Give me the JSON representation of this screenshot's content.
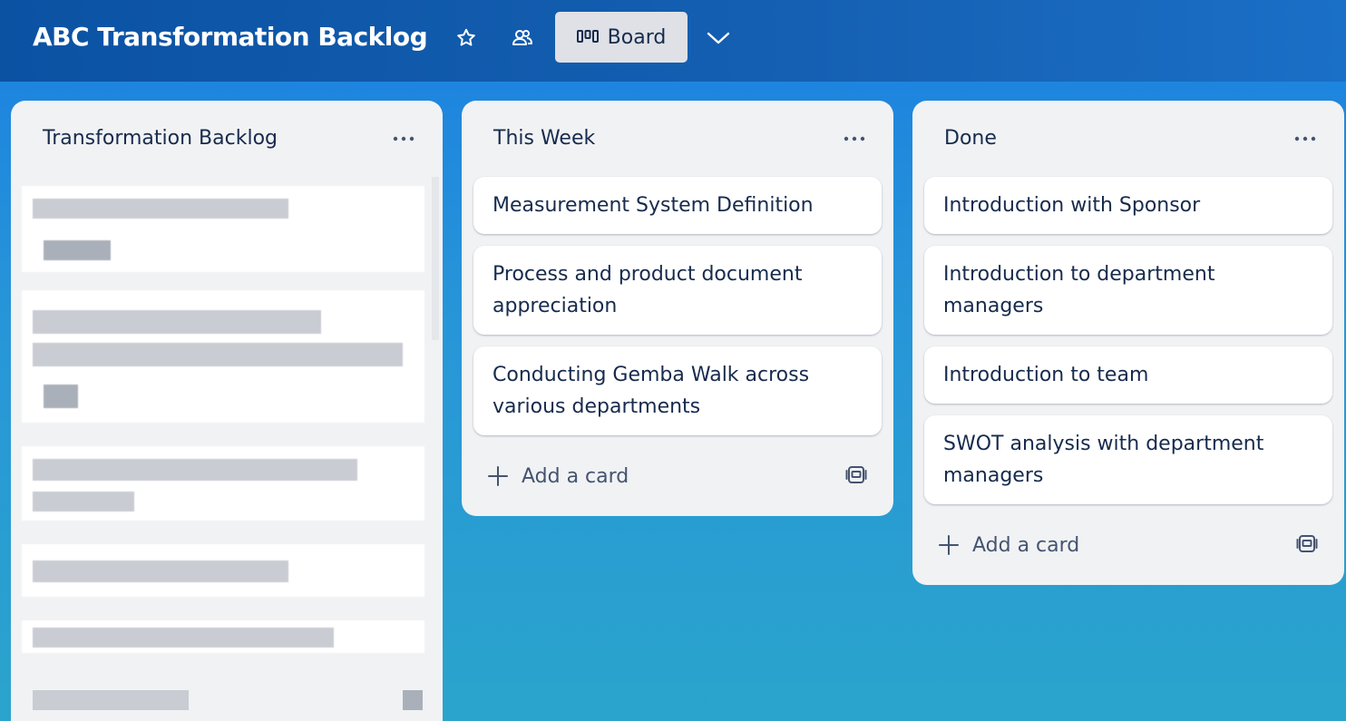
{
  "header": {
    "board_title": "ABC Transformation Backlog",
    "star_icon": "star-icon",
    "visibility_icon": "workspace-visibility-icon",
    "view_icon": "board-view-icon",
    "view_label": "Board",
    "view_switch_icon": "chevron-down-icon"
  },
  "lists": [
    {
      "title": "Transformation Backlog",
      "note": "card contents obscured/pixelated in screenshot"
    },
    {
      "title": "This Week",
      "cards": [
        "Measurement System Definition",
        "Process and product document appreciation",
        "Conducting Gemba Walk across various departments"
      ],
      "add_card_label": "Add a card"
    },
    {
      "title": "Done",
      "cards": [
        "Introduction with Sponsor",
        "Introduction to department managers",
        "Introduction to team",
        "SWOT analysis with department managers"
      ],
      "add_card_label": "Add a card"
    }
  ],
  "colors": {
    "header_bg": "#0b52a3",
    "board_bg_top": "#1b7fe0",
    "board_bg_bottom": "#2aa4cc",
    "list_bg": "#f1f2f4",
    "card_bg": "#ffffff",
    "text_primary": "#172b4d",
    "text_secondary": "#44546f"
  }
}
